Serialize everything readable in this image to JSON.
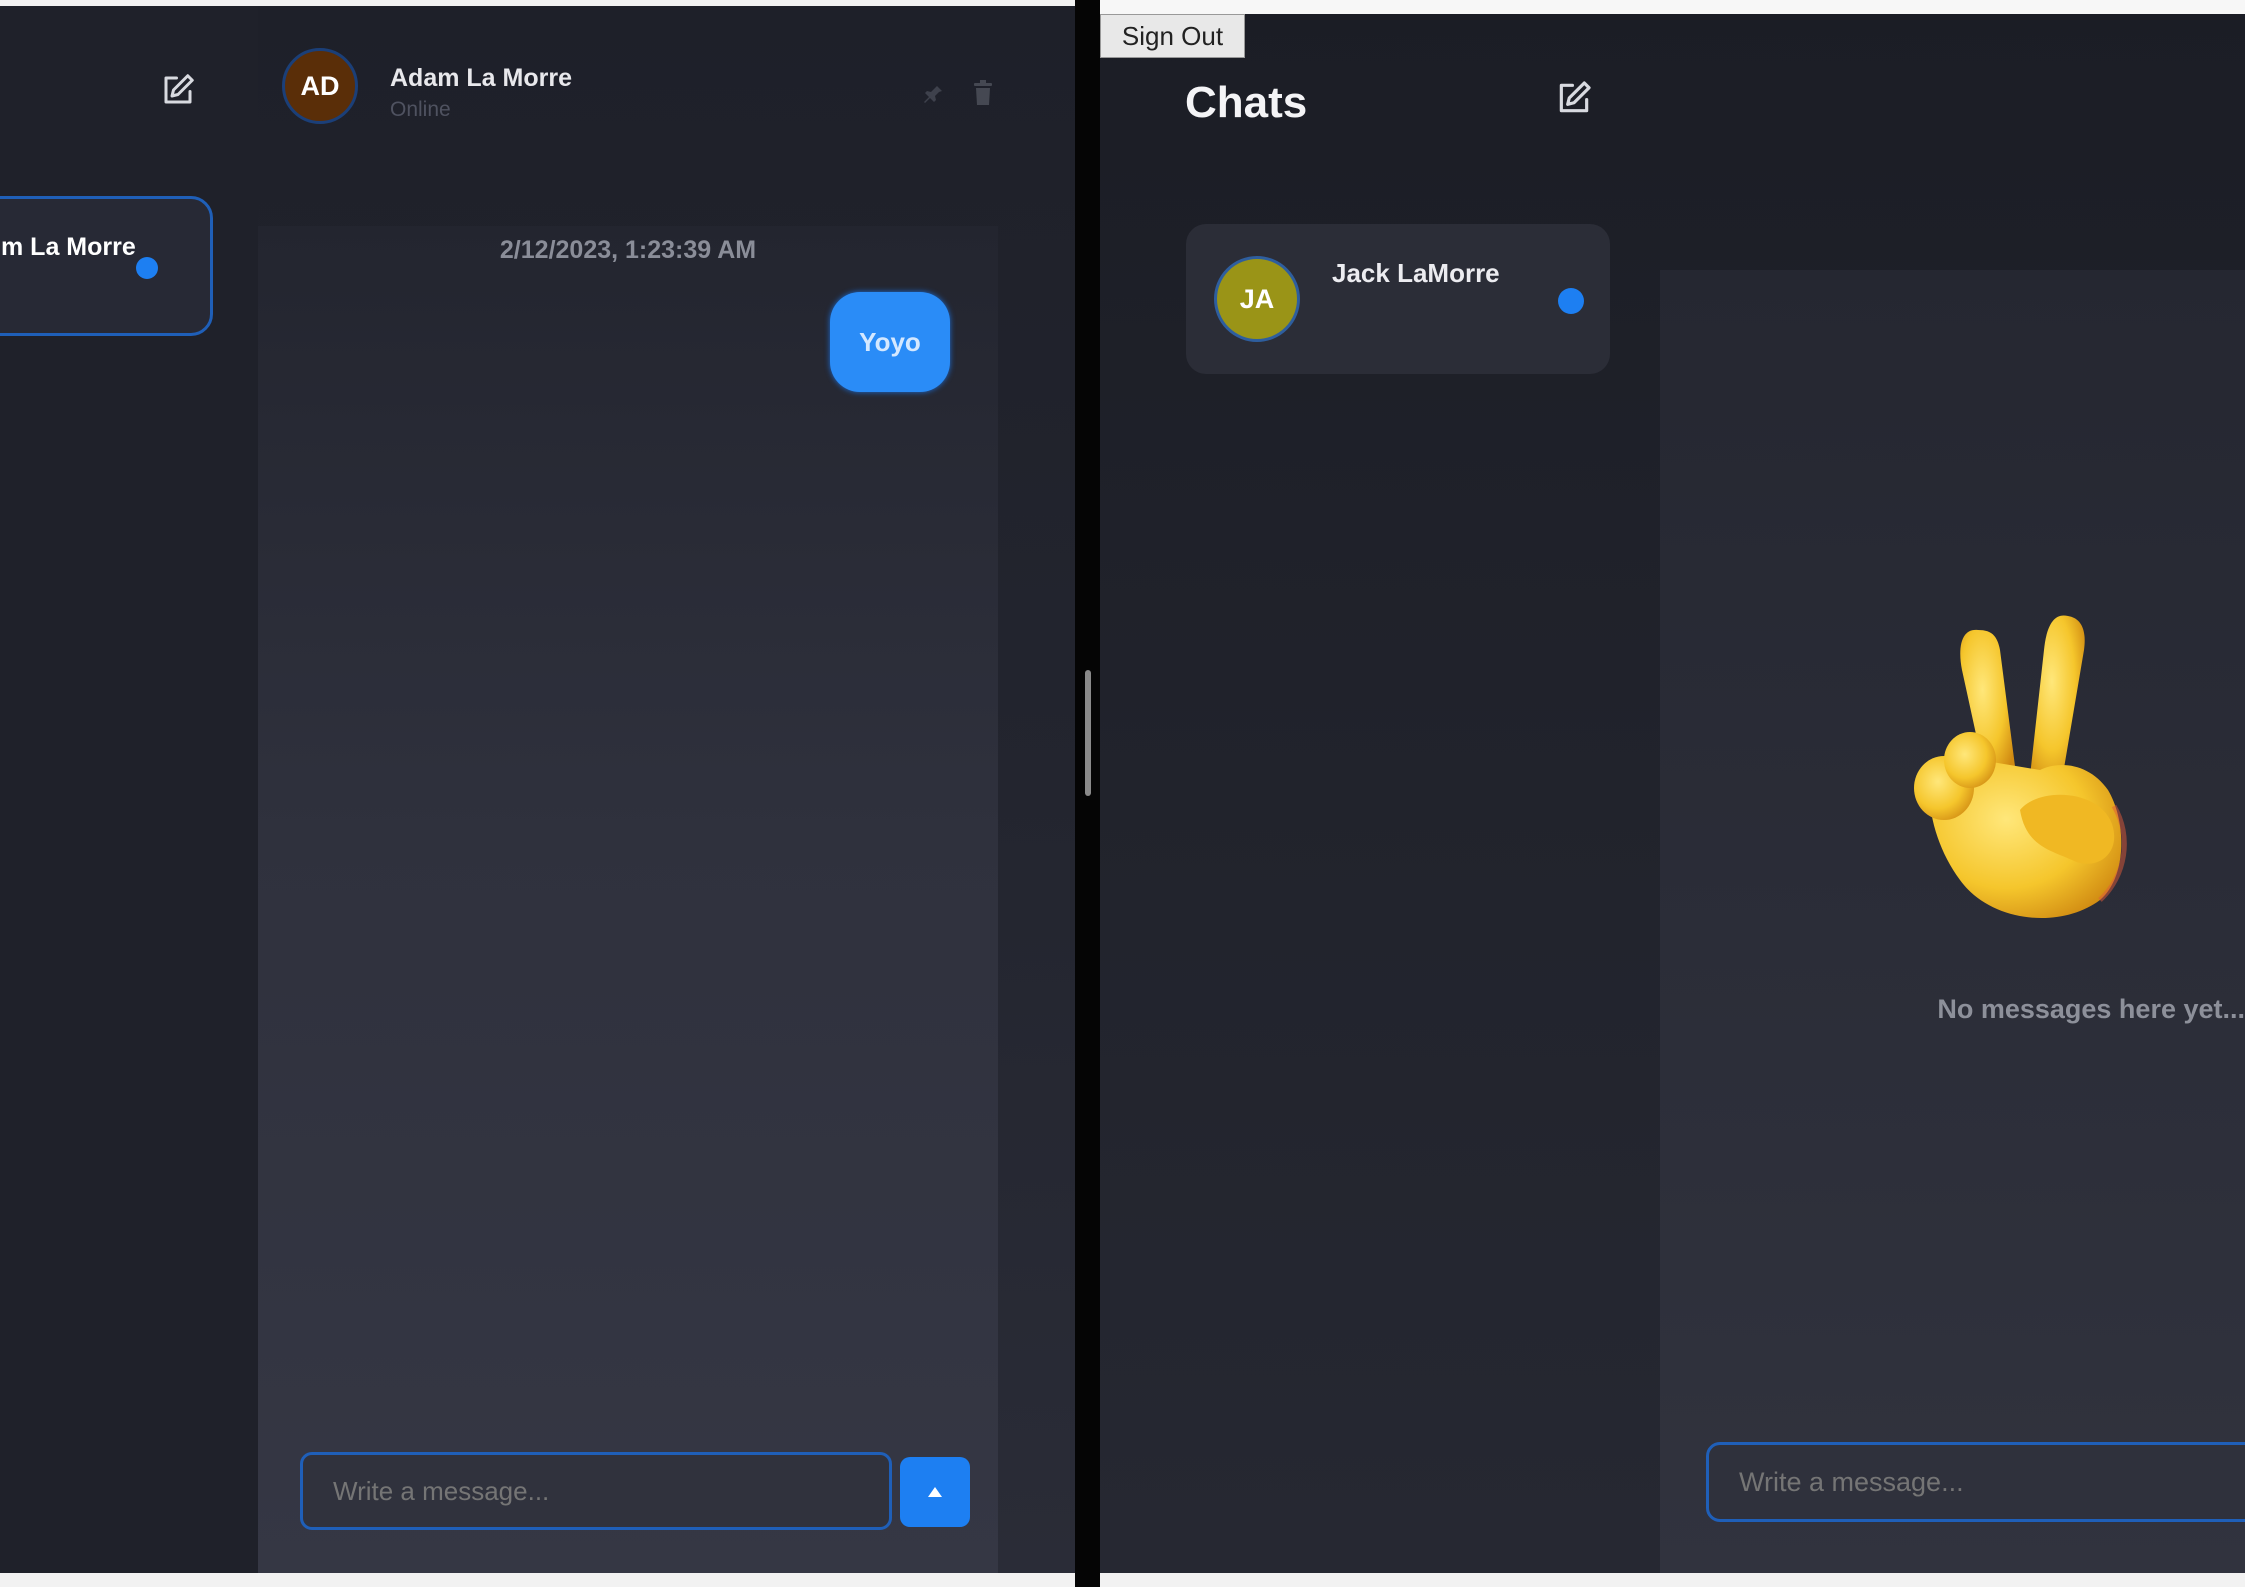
{
  "left_window": {
    "sidebar": {
      "compose_icon": "edit-icon",
      "active_chat": {
        "name": "m La Morre",
        "unread": true
      }
    },
    "header": {
      "avatar_initials": "AD",
      "name": "Adam La Morre",
      "status": "Online",
      "actions": [
        "pin-icon",
        "trash-icon"
      ]
    },
    "conversation": {
      "timestamp": "2/12/2023, 1:23:39 AM",
      "messages": [
        {
          "text": "Yoyo",
          "from": "me"
        }
      ]
    },
    "composer": {
      "placeholder": "Write a message...",
      "send_icon": "arrow-up-icon"
    }
  },
  "right_window": {
    "sign_out_label": "Sign Out",
    "sidebar": {
      "title": "Chats",
      "compose_icon": "edit-icon",
      "chats": [
        {
          "avatar_initials": "JA",
          "name": "Jack LaMorre",
          "unread": true
        }
      ]
    },
    "empty_state": {
      "emoji": "victory-hand-emoji",
      "text": "No messages here yet..."
    },
    "composer": {
      "placeholder": "Write a message..."
    }
  },
  "colors": {
    "accent": "#1d7ff2",
    "background": "#21232c",
    "avatar_ad": "#5a2e08",
    "avatar_ja": "#9a9417"
  }
}
